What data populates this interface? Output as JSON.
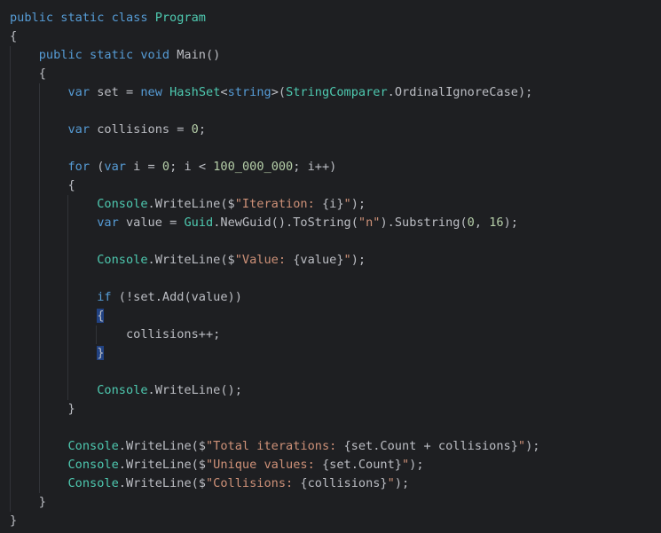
{
  "editor": {
    "colors": {
      "background": "#1e1f22",
      "keyword": "#569cd6",
      "type": "#4ec9b0",
      "string": "#ce9178",
      "number": "#b5cea8",
      "text": "#bcbec4",
      "matched_brace_bg": "#214283"
    },
    "lines": [
      [
        {
          "t": "public static class ",
          "c": "kw"
        },
        {
          "t": "Program",
          "c": "cls"
        }
      ],
      [
        {
          "t": "{",
          "c": "plain"
        }
      ],
      [
        {
          "t": "    ",
          "c": "plain"
        },
        {
          "t": "public static void ",
          "c": "kw"
        },
        {
          "t": "Main()",
          "c": "plain"
        }
      ],
      [
        {
          "t": "    {",
          "c": "plain"
        }
      ],
      [
        {
          "t": "        ",
          "c": "plain"
        },
        {
          "t": "var ",
          "c": "kw"
        },
        {
          "t": "set = ",
          "c": "plain"
        },
        {
          "t": "new ",
          "c": "kw"
        },
        {
          "t": "HashSet",
          "c": "cls"
        },
        {
          "t": "<",
          "c": "plain"
        },
        {
          "t": "string",
          "c": "kw"
        },
        {
          "t": ">(",
          "c": "plain"
        },
        {
          "t": "StringComparer",
          "c": "cls"
        },
        {
          "t": ".OrdinalIgnoreCase);",
          "c": "plain"
        }
      ],
      [],
      [
        {
          "t": "        ",
          "c": "plain"
        },
        {
          "t": "var ",
          "c": "kw"
        },
        {
          "t": "collisions = ",
          "c": "plain"
        },
        {
          "t": "0",
          "c": "num"
        },
        {
          "t": ";",
          "c": "plain"
        }
      ],
      [],
      [
        {
          "t": "        ",
          "c": "plain"
        },
        {
          "t": "for ",
          "c": "kw"
        },
        {
          "t": "(",
          "c": "plain"
        },
        {
          "t": "var ",
          "c": "kw"
        },
        {
          "t": "i = ",
          "c": "plain"
        },
        {
          "t": "0",
          "c": "num"
        },
        {
          "t": "; i < ",
          "c": "plain"
        },
        {
          "t": "100_000_000",
          "c": "num"
        },
        {
          "t": "; i++)",
          "c": "plain"
        }
      ],
      [
        {
          "t": "        {",
          "c": "plain"
        }
      ],
      [
        {
          "t": "            ",
          "c": "plain"
        },
        {
          "t": "Console",
          "c": "cls"
        },
        {
          "t": ".WriteLine($",
          "c": "plain"
        },
        {
          "t": "\"Iteration: ",
          "c": "str"
        },
        {
          "t": "{i}",
          "c": "interp"
        },
        {
          "t": "\"",
          "c": "str"
        },
        {
          "t": ");",
          "c": "plain"
        }
      ],
      [
        {
          "t": "            ",
          "c": "plain"
        },
        {
          "t": "var ",
          "c": "kw"
        },
        {
          "t": "value = ",
          "c": "plain"
        },
        {
          "t": "Guid",
          "c": "cls"
        },
        {
          "t": ".NewGuid().ToString(",
          "c": "plain"
        },
        {
          "t": "\"n\"",
          "c": "str"
        },
        {
          "t": ").Substring(",
          "c": "plain"
        },
        {
          "t": "0",
          "c": "num"
        },
        {
          "t": ", ",
          "c": "plain"
        },
        {
          "t": "16",
          "c": "num"
        },
        {
          "t": ");",
          "c": "plain"
        }
      ],
      [],
      [
        {
          "t": "            ",
          "c": "plain"
        },
        {
          "t": "Console",
          "c": "cls"
        },
        {
          "t": ".WriteLine($",
          "c": "plain"
        },
        {
          "t": "\"Value: ",
          "c": "str"
        },
        {
          "t": "{value}",
          "c": "interp"
        },
        {
          "t": "\"",
          "c": "str"
        },
        {
          "t": ");",
          "c": "plain"
        }
      ],
      [],
      [
        {
          "t": "            ",
          "c": "plain"
        },
        {
          "t": "if ",
          "c": "kw"
        },
        {
          "t": "(!set.Add(value))",
          "c": "plain"
        }
      ],
      [
        {
          "t": "            ",
          "c": "plain"
        },
        {
          "t": "{",
          "c": "brace-hl"
        }
      ],
      [
        {
          "t": "                collisions++;",
          "c": "plain"
        }
      ],
      [
        {
          "t": "            ",
          "c": "plain"
        },
        {
          "t": "}",
          "c": "brace-hl"
        }
      ],
      [],
      [
        {
          "t": "            ",
          "c": "plain"
        },
        {
          "t": "Console",
          "c": "cls"
        },
        {
          "t": ".WriteLine();",
          "c": "plain"
        }
      ],
      [
        {
          "t": "        }",
          "c": "plain"
        }
      ],
      [],
      [
        {
          "t": "        ",
          "c": "plain"
        },
        {
          "t": "Console",
          "c": "cls"
        },
        {
          "t": ".WriteLine($",
          "c": "plain"
        },
        {
          "t": "\"Total iterations: ",
          "c": "str"
        },
        {
          "t": "{set.Count + collisions}",
          "c": "interp"
        },
        {
          "t": "\"",
          "c": "str"
        },
        {
          "t": ");",
          "c": "plain"
        }
      ],
      [
        {
          "t": "        ",
          "c": "plain"
        },
        {
          "t": "Console",
          "c": "cls"
        },
        {
          "t": ".WriteLine($",
          "c": "plain"
        },
        {
          "t": "\"Unique values: ",
          "c": "str"
        },
        {
          "t": "{set.Count}",
          "c": "interp"
        },
        {
          "t": "\"",
          "c": "str"
        },
        {
          "t": ");",
          "c": "plain"
        }
      ],
      [
        {
          "t": "        ",
          "c": "plain"
        },
        {
          "t": "Console",
          "c": "cls"
        },
        {
          "t": ".WriteLine($",
          "c": "plain"
        },
        {
          "t": "\"Collisions: ",
          "c": "str"
        },
        {
          "t": "{collisions}",
          "c": "interp"
        },
        {
          "t": "\"",
          "c": "str"
        },
        {
          "t": ");",
          "c": "plain"
        }
      ],
      [
        {
          "t": "    }",
          "c": "plain"
        }
      ],
      [
        {
          "t": "}",
          "c": "plain"
        }
      ]
    ]
  }
}
